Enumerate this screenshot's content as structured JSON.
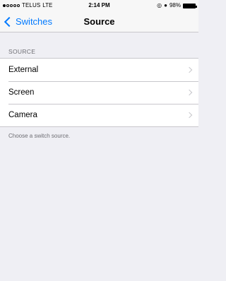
{
  "status_bar": {
    "carrier": "TELUS",
    "network": "LTE",
    "time": "2:14 PM",
    "battery_percent": "98%",
    "battery_level": 0.98,
    "signal_bars_filled": 1,
    "signal_bars_total": 5,
    "icons": [
      "signal-icon",
      "location-icon",
      "alarm-icon",
      "battery-icon"
    ]
  },
  "nav": {
    "back_label": "Switches",
    "title": "Source"
  },
  "section": {
    "header": "SOURCE",
    "items": [
      {
        "label": "External"
      },
      {
        "label": "Screen"
      },
      {
        "label": "Camera"
      }
    ],
    "footer": "Choose a switch source."
  },
  "colors": {
    "accent": "#007aff",
    "background": "#efeff4",
    "separator": "#c8c7cc",
    "secondary_text": "#6d6d72"
  }
}
